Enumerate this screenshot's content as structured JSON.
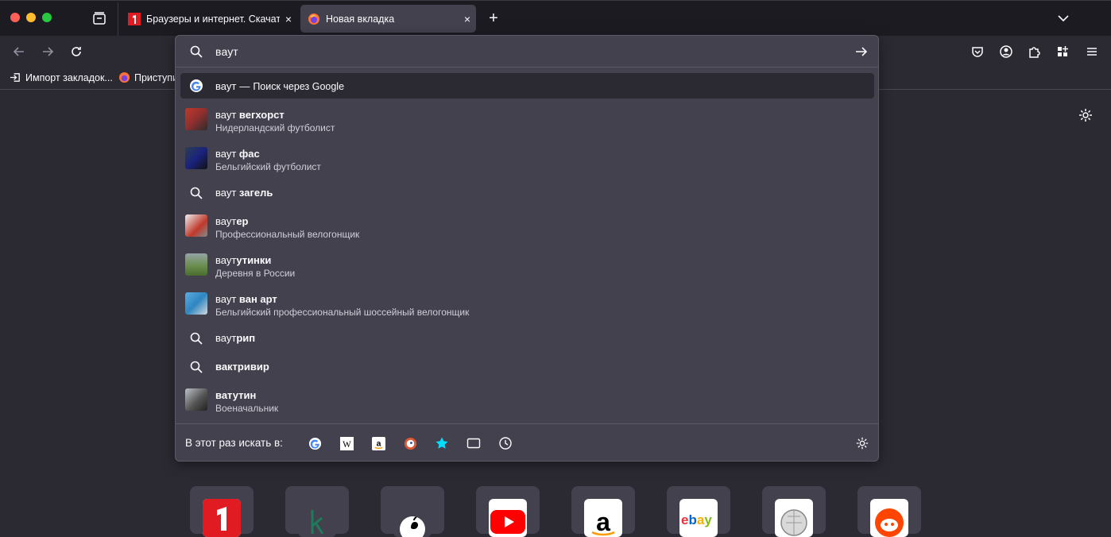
{
  "window": {
    "tabs": [
      {
        "title": "Браузеры и интернет. Скачать",
        "favicon": "1-logo"
      },
      {
        "title": "Новая вкладка",
        "favicon": "firefox-icon"
      }
    ],
    "new_tab_label": "+",
    "close_label": "×"
  },
  "bookmarks": [
    {
      "label": "Импорт закладок...",
      "icon": "import-icon"
    },
    {
      "label": "Приступи",
      "icon": "firefox-icon"
    }
  ],
  "urlbar": {
    "query": "вaут",
    "results": [
      {
        "prefix": "ваут",
        "bold": "",
        "engine_sep": "—",
        "engine": "Поиск через Google",
        "type": "google"
      },
      {
        "prefix": "ваут ",
        "bold": "вегхорст",
        "sub": "Нидерландский футболист",
        "type": "thumb"
      },
      {
        "prefix": "ваут ",
        "bold": "фас",
        "sub": "Бельгийский футболист",
        "type": "thumb"
      },
      {
        "prefix": "ваут ",
        "bold": "загель",
        "type": "search"
      },
      {
        "prefix": "ваут",
        "bold": "ер",
        "sub": "Профессиональный велогонщик",
        "type": "thumb"
      },
      {
        "prefix": "ваут",
        "bold": "утинки",
        "sub": "Деревня в России",
        "type": "thumb"
      },
      {
        "prefix": "ваут ",
        "bold": "ван арт",
        "sub": "Бельгийский профессиональный шоссейный велогонщик",
        "type": "thumb"
      },
      {
        "prefix": "ваут",
        "bold": "рип",
        "type": "search"
      },
      {
        "prefix": "",
        "bold": "вактривир",
        "type": "search"
      },
      {
        "prefix": "",
        "bold": "ватутин",
        "sub": "Военачальник",
        "type": "thumb"
      }
    ],
    "oneoff_label": "В этот раз искать в:",
    "oneoff_engines": [
      "google-icon",
      "wikipedia-icon",
      "amazon-icon",
      "duckduckgo-icon",
      "bookmarks-star-icon",
      "tabs-icon",
      "history-clock-icon"
    ]
  },
  "shortcuts": [
    {
      "name": "1-logo",
      "bg": "#ffffff"
    },
    {
      "name": "k-logo",
      "bg": "#42414d"
    },
    {
      "name": "apple-logo",
      "bg": "#ffffff"
    },
    {
      "name": "youtube-logo",
      "bg": "#ffffff"
    },
    {
      "name": "amazon-logo",
      "bg": "#ffffff"
    },
    {
      "name": "ebay-logo",
      "bg": "#ffffff",
      "text": "ebay"
    },
    {
      "name": "wikipedia-logo",
      "bg": "#ffffff"
    },
    {
      "name": "reddit-logo",
      "bg": "#ffffff"
    }
  ],
  "colors": {
    "accent": "#00ddff",
    "window_bg": "#2b2a33",
    "panel_bg": "#42414d"
  }
}
